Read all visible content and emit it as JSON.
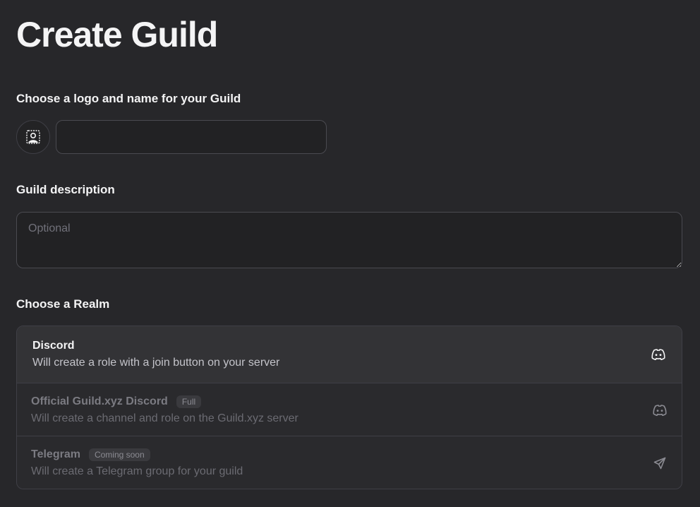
{
  "title": "Create Guild",
  "logo_section": {
    "label": "Choose a logo and name for your Guild",
    "name_value": "",
    "logo_icon": "photo-upload-icon"
  },
  "description": {
    "label": "Guild description",
    "placeholder": "Optional",
    "value": ""
  },
  "realm": {
    "label": "Choose a Realm",
    "options": [
      {
        "name": "Discord",
        "description": "Will create a role with a join button on your server",
        "badge": "",
        "icon": "discord-icon",
        "state": "selected"
      },
      {
        "name": "Official Guild.xyz Discord",
        "description": "Will create a channel and role on the Guild.xyz server",
        "badge": "Full",
        "icon": "discord-icon",
        "state": "disabled"
      },
      {
        "name": "Telegram",
        "description": "Will create a Telegram group for your guild",
        "badge": "Coming soon",
        "icon": "telegram-icon",
        "state": "disabled"
      }
    ]
  }
}
